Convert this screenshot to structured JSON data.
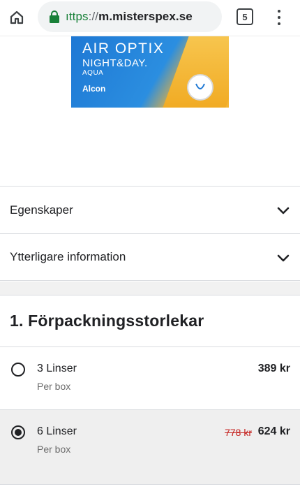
{
  "browser": {
    "url_scheme": "ıttps",
    "url_sep": "://",
    "url_host": "m.misterspex.se",
    "tab_count": "5"
  },
  "product_image": {
    "brand_line1": "AIR OPTIX",
    "brand_line2": "NIGHT&DAY.",
    "brand_line3": "AQUA",
    "manufacturer": "Alcon",
    "colors": {
      "blue": "#1e78d4",
      "yellow": "#f2b233"
    }
  },
  "accordions": [
    {
      "label": "Egenskaper",
      "icon": "chevron-down-icon"
    },
    {
      "label": "Ytterligare information",
      "icon": "chevron-down-icon"
    }
  ],
  "section": {
    "title": "1. Förpackningsstorlekar"
  },
  "options": [
    {
      "title": "3 Linser",
      "subtitle": "Per box",
      "price": "389 kr",
      "old_price": "",
      "selected": false
    },
    {
      "title": "6 Linser",
      "subtitle": "Per box",
      "price": "624 kr",
      "old_price": "778 kr",
      "selected": true
    }
  ],
  "colors": {
    "text": "#202124",
    "muted": "#6b6b6b",
    "strike": "#c5221f",
    "selected_bg": "#efefef",
    "https_green": "#188038"
  }
}
